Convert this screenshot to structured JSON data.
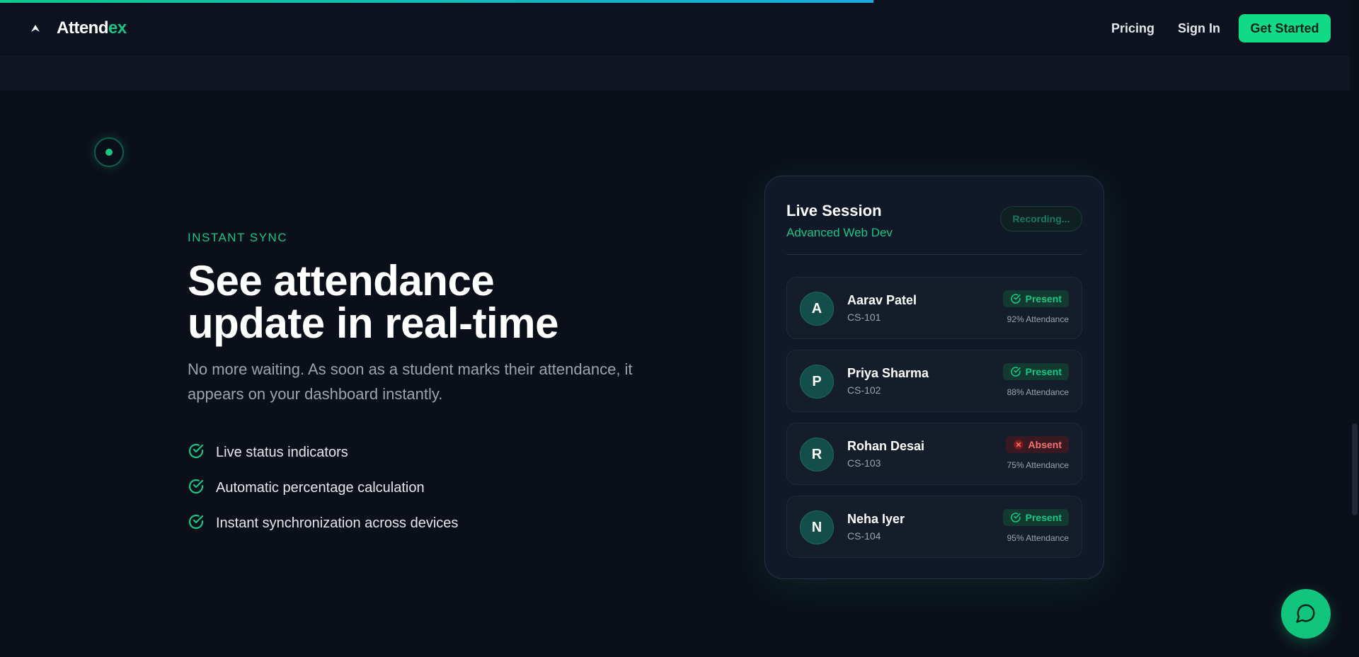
{
  "nav": {
    "brand_prefix": "Attend",
    "brand_accent": "ex",
    "links": [
      "Pricing",
      "Sign In"
    ],
    "cta_label": "Get Started"
  },
  "hero": {
    "eyebrow": "INSTANT SYNC",
    "headline_line1": "See attendance",
    "headline_line2": "update in real-time",
    "lead": "No more waiting. As soon as a student marks their attendance, it appears on your dashboard instantly.",
    "features": [
      "Live status indicators",
      "Automatic percentage calculation",
      "Instant synchronization across devices"
    ]
  },
  "session": {
    "title": "Live Session",
    "course": "Advanced Web Dev",
    "status_label": "Recording...",
    "students": [
      {
        "initial": "A",
        "name": "Aarav Patel",
        "id": "CS-101",
        "status": "Present",
        "attendance": "92% Attendance"
      },
      {
        "initial": "P",
        "name": "Priya Sharma",
        "id": "CS-102",
        "status": "Present",
        "attendance": "88% Attendance"
      },
      {
        "initial": "R",
        "name": "Rohan Desai",
        "id": "CS-103",
        "status": "Absent",
        "attendance": "75% Attendance"
      },
      {
        "initial": "N",
        "name": "Neha Iyer",
        "id": "CS-104",
        "status": "Present",
        "attendance": "95% Attendance"
      }
    ]
  },
  "colors": {
    "accent": "#16c784",
    "background": "#0b0f19",
    "absent": "#f87171"
  },
  "icons": {
    "brand": "chevron-up-icon",
    "feature": "check-circle-icon",
    "present": "check-circle-icon",
    "absent": "x-circle-icon",
    "chat": "chat-bubble-icon"
  }
}
